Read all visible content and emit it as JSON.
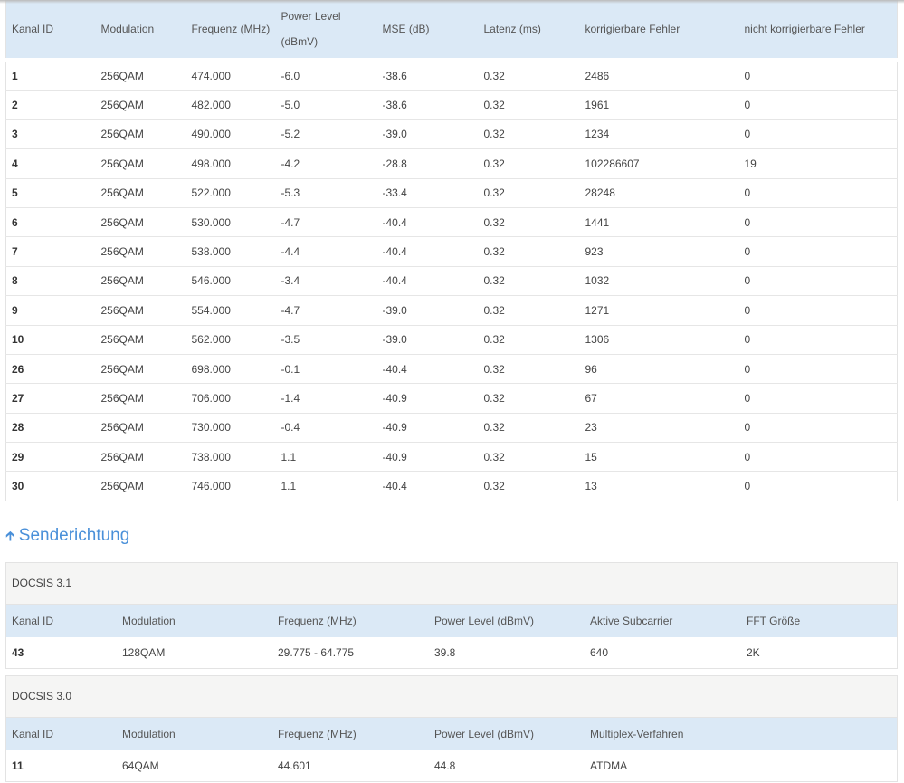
{
  "downstream": {
    "headers": [
      "Kanal ID",
      "Modulation",
      "Frequenz (MHz)",
      "Power Level",
      "(dBmV)",
      "MSE (dB)",
      "Latenz (ms)",
      "korrigierbare Fehler",
      "nicht korrigierbare Fehler"
    ],
    "rows": [
      [
        "1",
        "256QAM",
        "474.000",
        "-6.0",
        "-38.6",
        "0.32",
        "2486",
        "0"
      ],
      [
        "2",
        "256QAM",
        "482.000",
        "-5.0",
        "-38.6",
        "0.32",
        "1961",
        "0"
      ],
      [
        "3",
        "256QAM",
        "490.000",
        "-5.2",
        "-39.0",
        "0.32",
        "1234",
        "0"
      ],
      [
        "4",
        "256QAM",
        "498.000",
        "-4.2",
        "-28.8",
        "0.32",
        "102286607",
        "19"
      ],
      [
        "5",
        "256QAM",
        "522.000",
        "-5.3",
        "-33.4",
        "0.32",
        "28248",
        "0"
      ],
      [
        "6",
        "256QAM",
        "530.000",
        "-4.7",
        "-40.4",
        "0.32",
        "1441",
        "0"
      ],
      [
        "7",
        "256QAM",
        "538.000",
        "-4.4",
        "-40.4",
        "0.32",
        "923",
        "0"
      ],
      [
        "8",
        "256QAM",
        "546.000",
        "-3.4",
        "-40.4",
        "0.32",
        "1032",
        "0"
      ],
      [
        "9",
        "256QAM",
        "554.000",
        "-4.7",
        "-39.0",
        "0.32",
        "1271",
        "0"
      ],
      [
        "10",
        "256QAM",
        "562.000",
        "-3.5",
        "-39.0",
        "0.32",
        "1306",
        "0"
      ],
      [
        "26",
        "256QAM",
        "698.000",
        "-0.1",
        "-40.4",
        "0.32",
        "96",
        "0"
      ],
      [
        "27",
        "256QAM",
        "706.000",
        "-1.4",
        "-40.9",
        "0.32",
        "67",
        "0"
      ],
      [
        "28",
        "256QAM",
        "730.000",
        "-0.4",
        "-40.9",
        "0.32",
        "23",
        "0"
      ],
      [
        "29",
        "256QAM",
        "738.000",
        "1.1",
        "-40.9",
        "0.32",
        "15",
        "0"
      ],
      [
        "30",
        "256QAM",
        "746.000",
        "1.1",
        "-40.4",
        "0.32",
        "13",
        "0"
      ]
    ]
  },
  "upstream": {
    "title": "Senderichtung",
    "docsis31": {
      "title": "DOCSIS 3.1",
      "headers": [
        "Kanal ID",
        "Modulation",
        "Frequenz (MHz)",
        "Power Level (dBmV)",
        "Aktive Subcarrier",
        "FFT Größe"
      ],
      "rows": [
        [
          "43",
          "128QAM",
          "29.775 - 64.775",
          "39.8",
          "640",
          "2K"
        ]
      ]
    },
    "docsis30": {
      "title": "DOCSIS 3.0",
      "headers": [
        "Kanal ID",
        "Modulation",
        "Frequenz (MHz)",
        "Power Level (dBmV)",
        "Multiplex-Verfahren"
      ],
      "rows": [
        [
          "11",
          "64QAM",
          "44.601",
          "44.8",
          "ATDMA"
        ]
      ]
    }
  }
}
